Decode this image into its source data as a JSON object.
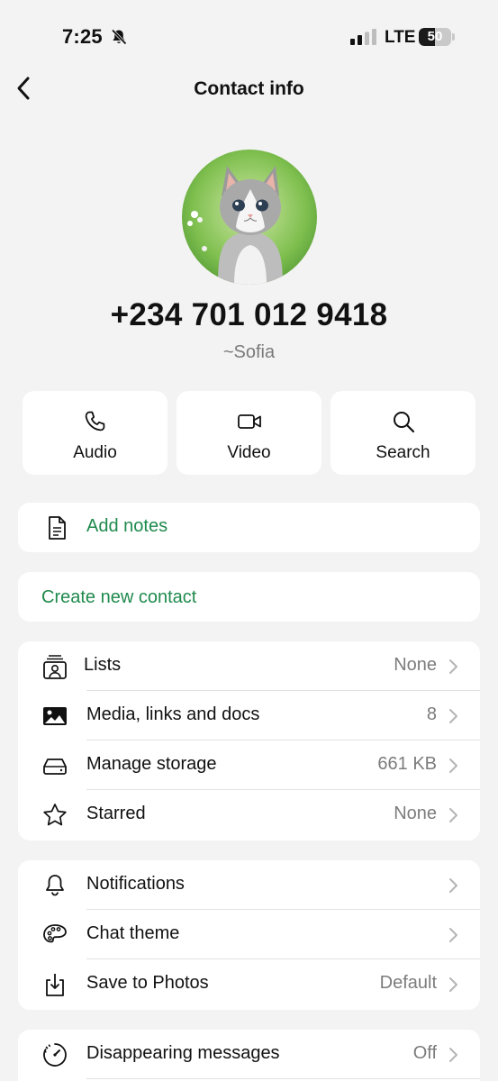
{
  "status_bar": {
    "time": "7:25",
    "network": "LTE",
    "battery": "50",
    "battery_level": 0.5
  },
  "nav": {
    "title": "Contact info"
  },
  "contact": {
    "phone": "+234 701 012 9418",
    "alias": "~Sofia"
  },
  "actions": [
    {
      "label": "Audio",
      "icon": "phone-icon"
    },
    {
      "label": "Video",
      "icon": "video-icon"
    },
    {
      "label": "Search",
      "icon": "search-icon"
    }
  ],
  "notes": {
    "label": "Add notes",
    "icon": "document-icon"
  },
  "create_contact": {
    "label": "Create new contact"
  },
  "media_section": [
    {
      "label": "Lists",
      "value": "None",
      "icon": "lists-icon"
    },
    {
      "label": "Media, links and docs",
      "value": "8",
      "icon": "image-icon"
    },
    {
      "label": "Manage storage",
      "value": "661 KB",
      "icon": "storage-icon"
    },
    {
      "label": "Starred",
      "value": "None",
      "icon": "star-icon"
    }
  ],
  "settings_section": [
    {
      "label": "Notifications",
      "value": "",
      "icon": "bell-icon"
    },
    {
      "label": "Chat theme",
      "value": "",
      "icon": "palette-icon"
    },
    {
      "label": "Save to Photos",
      "value": "Default",
      "icon": "save-icon"
    }
  ],
  "privacy_section": [
    {
      "label": "Disappearing messages",
      "value": "Off",
      "icon": "timer-icon"
    }
  ],
  "colors": {
    "accent": "#1f8a4d",
    "background": "#f3f3f3",
    "card": "#ffffff"
  }
}
